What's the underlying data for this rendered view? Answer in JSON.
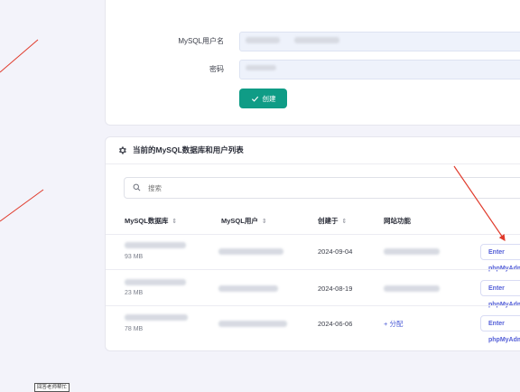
{
  "form": {
    "mysql_user_label": "MySQL用户名",
    "password_label": "密码",
    "create_button": "创建"
  },
  "db_section": {
    "title": "当前的MySQL数据库和用户列表",
    "search_placeholder": "搜索",
    "columns": [
      "MySQL数据库",
      "MySQL用户",
      "创建于",
      "网站功能"
    ],
    "rows": [
      {
        "size": "93 MB",
        "created": "2024-09-04",
        "action": "Enter phpMyAdmin"
      },
      {
        "size": "23 MB",
        "created": "2024-08-19",
        "action": "Enter phpMyAdmin"
      },
      {
        "size": "78 MB",
        "created": "2024-06-06",
        "assign": "+ 分配",
        "action": "Enter phpMyAdmin"
      }
    ]
  },
  "footer_badge": "回答老师帮忙",
  "colors": {
    "accent": "#0f9c86",
    "link": "#4b5bd6",
    "arrow": "#e03a2b"
  },
  "icons": [
    "check-icon",
    "gear-icon",
    "search-icon",
    "sort-icon"
  ]
}
